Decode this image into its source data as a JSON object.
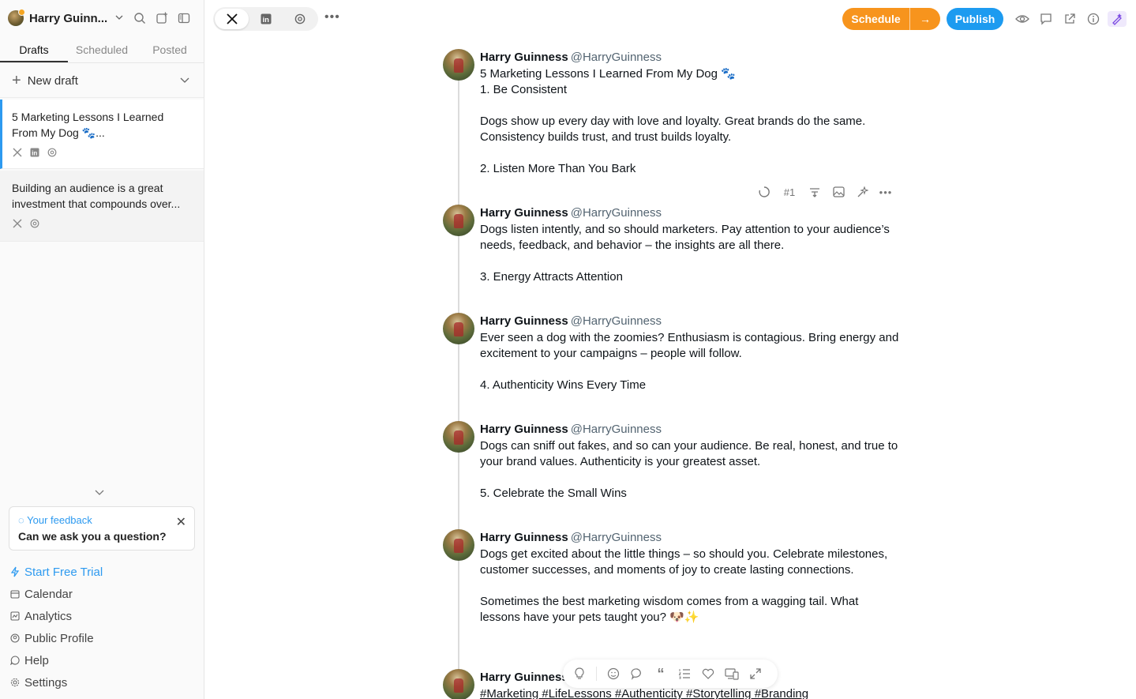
{
  "account": {
    "name": "Harry Guinn..."
  },
  "tabs": [
    {
      "label": "Drafts"
    },
    {
      "label": "Scheduled"
    },
    {
      "label": "Posted"
    }
  ],
  "new_draft": {
    "label": "New draft"
  },
  "drafts": [
    {
      "text": "5 Marketing Lessons I Learned From My Dog 🐾..."
    },
    {
      "text": "Building an audience is a great investment that compounds over..."
    }
  ],
  "feedback": {
    "title": "Your feedback",
    "question": "Can we ask you a question?"
  },
  "menu": {
    "trial": "Start Free Trial",
    "calendar": "Calendar",
    "analytics": "Analytics",
    "profile": "Public Profile",
    "help": "Help",
    "settings": "Settings"
  },
  "toolbar": {
    "schedule": "Schedule",
    "schedule_arrow": "→",
    "publish": "Publish"
  },
  "thread_tools": {
    "tweet_number": "#1"
  },
  "author": {
    "name": "Harry Guinness",
    "handle": "@HarryGuinness",
    "truncated_name": "Harry Guinness"
  },
  "tweets": [
    {
      "text": "5 Marketing Lessons I Learned From My Dog 🐾\n1. Be Consistent\n\nDogs show up every day with love and loyalty. Great brands do the same. Consistency builds trust, and trust builds loyalty.\n\n2. Listen More Than You Bark"
    },
    {
      "text": "Dogs listen intently, and so should marketers. Pay attention to your audience’s needs, feedback, and behavior – the insights are all there.\n\n3. Energy Attracts Attention"
    },
    {
      "text": "Ever seen a dog with the zoomies? Enthusiasm is contagious. Bring energy and excitement to your campaigns – people will follow.\n\n4. Authenticity Wins Every Time"
    },
    {
      "text": "Dogs can sniff out fakes, and so can your audience. Be real, honest, and true to your brand values. Authenticity is your greatest asset.\n\n5. Celebrate the Small Wins"
    },
    {
      "text": "Dogs get excited about the little things – so should you. Celebrate milestones, customer successes, and moments of joy to create lasting connections.\n\nSometimes the best marketing wisdom comes from a wagging tail. What lessons have your pets taught you? 🐶✨"
    },
    {
      "text": "#Marketing #LifeLessons #Authenticity #Storytelling #Branding"
    }
  ],
  "colors": {
    "accent_blue": "#1d9bf0",
    "schedule_orange": "#f7941d",
    "ai_purple": "#7b4ae2"
  }
}
